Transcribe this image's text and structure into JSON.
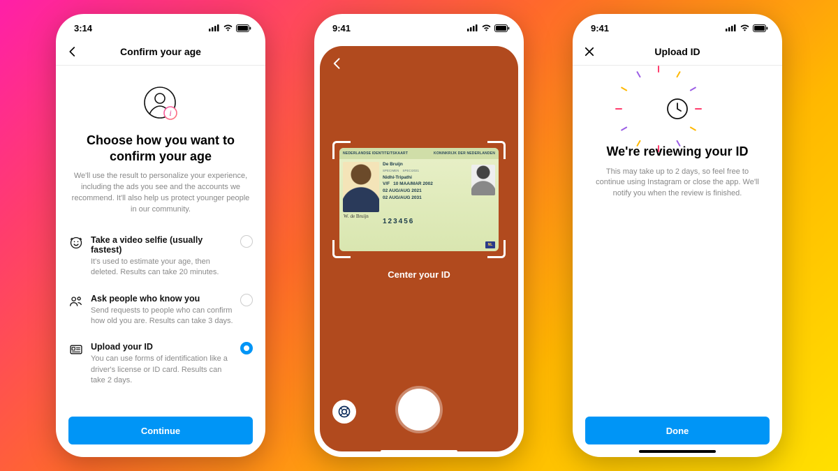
{
  "phone1": {
    "time": "3:14",
    "header_title": "Confirm your age",
    "heading": "Choose how you want to confirm your age",
    "subtext": "We'll use the result to personalize your experience, including the ads you see and the accounts we recommend. It'll also help us protect younger people in our community.",
    "options": [
      {
        "label": "Take a video selfie (usually fastest)",
        "desc": "It's used to estimate your age, then deleted. Results can take 20 minutes.",
        "selected": false
      },
      {
        "label": "Ask people who know you",
        "desc": "Send requests to people who can confirm how old you are. Results can take 3 days.",
        "selected": false
      },
      {
        "label": "Upload your ID",
        "desc": "You can use forms of identification like a driver's license or ID card. Results can take 2 days.",
        "selected": true
      }
    ],
    "cta": "Continue"
  },
  "phone2": {
    "time": "9:41",
    "hint": "Center your ID",
    "id": {
      "top_left": "NEDERLANDSE IDENTITEITSKAART",
      "top_right": "KONINKRIJK DER NEDERLANDEN",
      "surname": "De Bruijn",
      "specimen": "SPECIMEN",
      "given": "Nidhi-Tripathi",
      "code": "SPECI2021",
      "sex": "V/F",
      "dob": "10 MAA/MAR 2002",
      "issue": "02 AUG/AUG 2021",
      "expiry": "02 AUG/AUG 2031",
      "docnum": "123456",
      "flag": "NL"
    }
  },
  "phone3": {
    "time": "9:41",
    "header_title": "Upload ID",
    "heading": "We're reviewing your ID",
    "subtext": "This may take up to 2 days, so feel free to continue using Instagram or close the app. We'll notify you when the review is finished.",
    "cta": "Done"
  }
}
